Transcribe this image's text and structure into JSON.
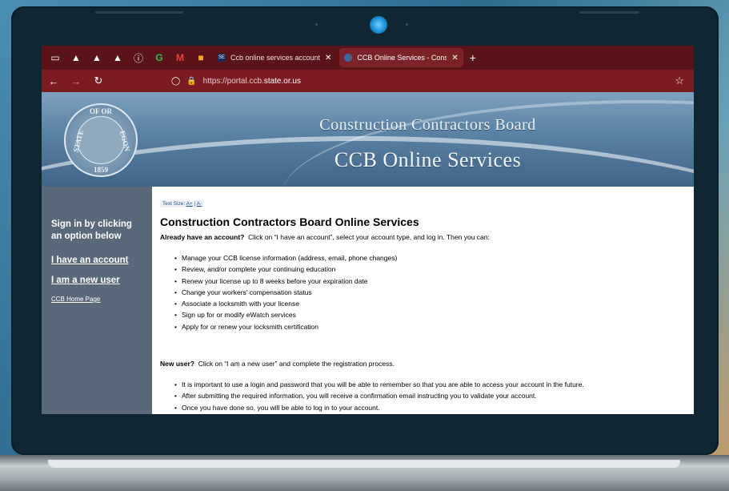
{
  "browser": {
    "tabs": [
      {
        "favicon": "SE",
        "title": "Ccb online services account sta",
        "active": false
      },
      {
        "favicon": "",
        "title": "CCB Online Services - Construct",
        "active": true
      }
    ],
    "url_prefix": "https://portal.ccb.",
    "url_domain": "state.or.us"
  },
  "banner": {
    "title_top": "Construction Contractors Board",
    "title_main": "CCB Online Services",
    "seal_top": "OF  OR",
    "seal_left": "STATE",
    "seal_right": "EGON",
    "seal_year": "1859"
  },
  "sidebar": {
    "heading": "Sign in by clicking an option below",
    "links": [
      {
        "label": "I have an account"
      },
      {
        "label": "I am a new user"
      }
    ],
    "home_link": "CCB Home Page"
  },
  "content": {
    "text_size_label": "Text Size:",
    "text_size_plus": "A+",
    "text_size_sep": "|",
    "text_size_minus": "A-",
    "title": "Construction Contractors Board Online Services",
    "existing_lead": "Already have an account?",
    "existing_text": "Click on “I have an account”, select your account type, and log in.  Then you can:",
    "existing_items": [
      "Manage your CCB license information (address, email, phone changes)",
      "Review, and/or complete your continuing education",
      "Renew your license up to 8 weeks before your expiration date",
      "Change your workers’ compensation status",
      "Associate a locksmith with your license",
      "Sign up for or modify eWatch services",
      "Apply for or renew your locksmith certification"
    ],
    "new_lead": "New user?",
    "new_text": "Click on “I am a new user” and complete the registration process.",
    "new_items": [
      "It is important to use a login and password that you will be able to remember so that you are able to access your account in the future.",
      "After submitting the required information, you will receive a confirmation email instructing you to validate your account.",
      "Once you have done so, you will be able to log in to your account."
    ]
  }
}
